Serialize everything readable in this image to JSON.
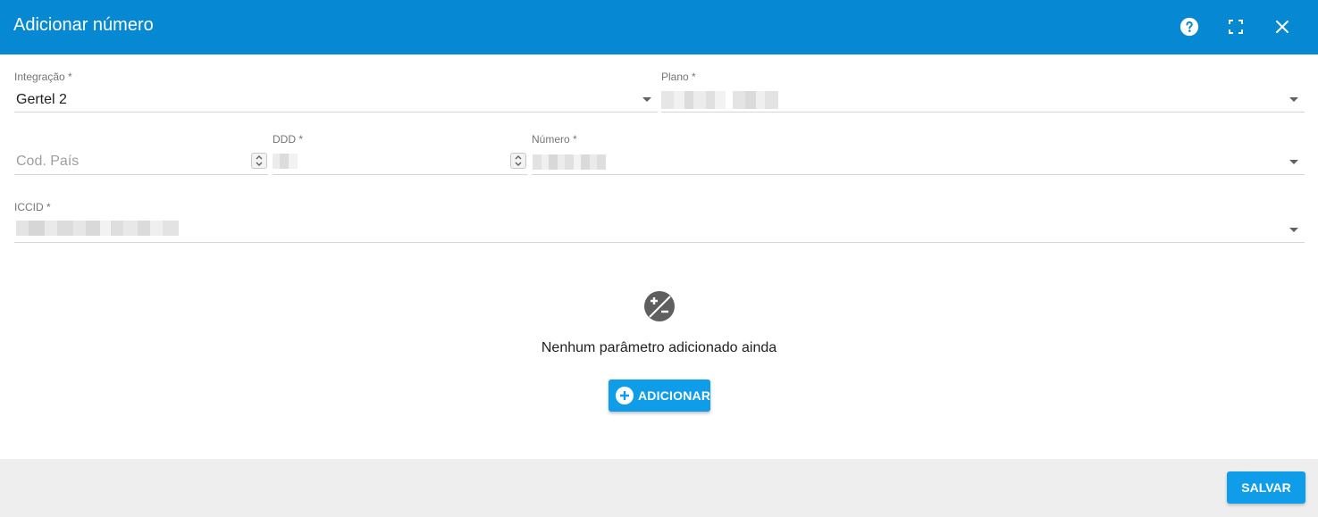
{
  "dialog": {
    "title": "Adicionar número"
  },
  "header": {
    "icons": [
      "help-icon",
      "fullscreen-icon",
      "close-icon"
    ]
  },
  "form": {
    "integracao": {
      "label": "Integração *",
      "value": "Gertel 2"
    },
    "plano": {
      "label": "Plano *",
      "value": ""
    },
    "cod_pais": {
      "placeholder": "Cod. País",
      "value": ""
    },
    "ddd": {
      "label": "DDD *",
      "value": ""
    },
    "numero": {
      "label": "Número *",
      "value": ""
    },
    "iccid": {
      "label": "ICCID *",
      "value": ""
    }
  },
  "params": {
    "empty_message": "Nenhum parâmetro adicionado ainda",
    "add_label": "ADICIONAR"
  },
  "footer": {
    "save_label": "SALVAR"
  },
  "colors": {
    "header_bg": "#0788d3",
    "button_bg": "#0f9ce8",
    "footer_bg": "#eeeeee"
  }
}
